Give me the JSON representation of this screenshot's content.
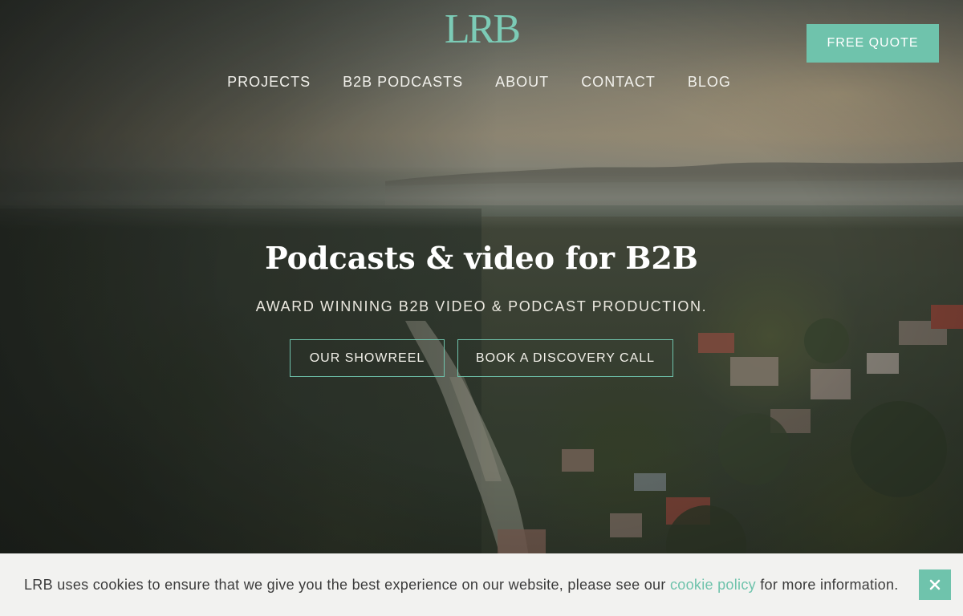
{
  "brand": {
    "logo_text": "LRB",
    "accent_color": "#6fc3ac"
  },
  "nav": {
    "items": [
      {
        "label": "PROJECTS"
      },
      {
        "label": "B2B PODCASTS"
      },
      {
        "label": "ABOUT"
      },
      {
        "label": "CONTACT"
      },
      {
        "label": "BLOG"
      }
    ]
  },
  "header": {
    "quote_label": "FREE QUOTE"
  },
  "hero": {
    "title": "Podcasts & video for B2B",
    "subtitle": "AWARD WINNING B2B VIDEO & PODCAST PRODUCTION.",
    "showreel_label": "OUR SHOWREEL",
    "discovery_label": "BOOK A DISCOVERY CALL"
  },
  "cookie": {
    "text_before": "LRB uses cookies to ensure that we give you the best experience on our website, please see our ",
    "link_label": "cookie policy",
    "text_after": " for more information.",
    "close_icon": "close-icon"
  }
}
